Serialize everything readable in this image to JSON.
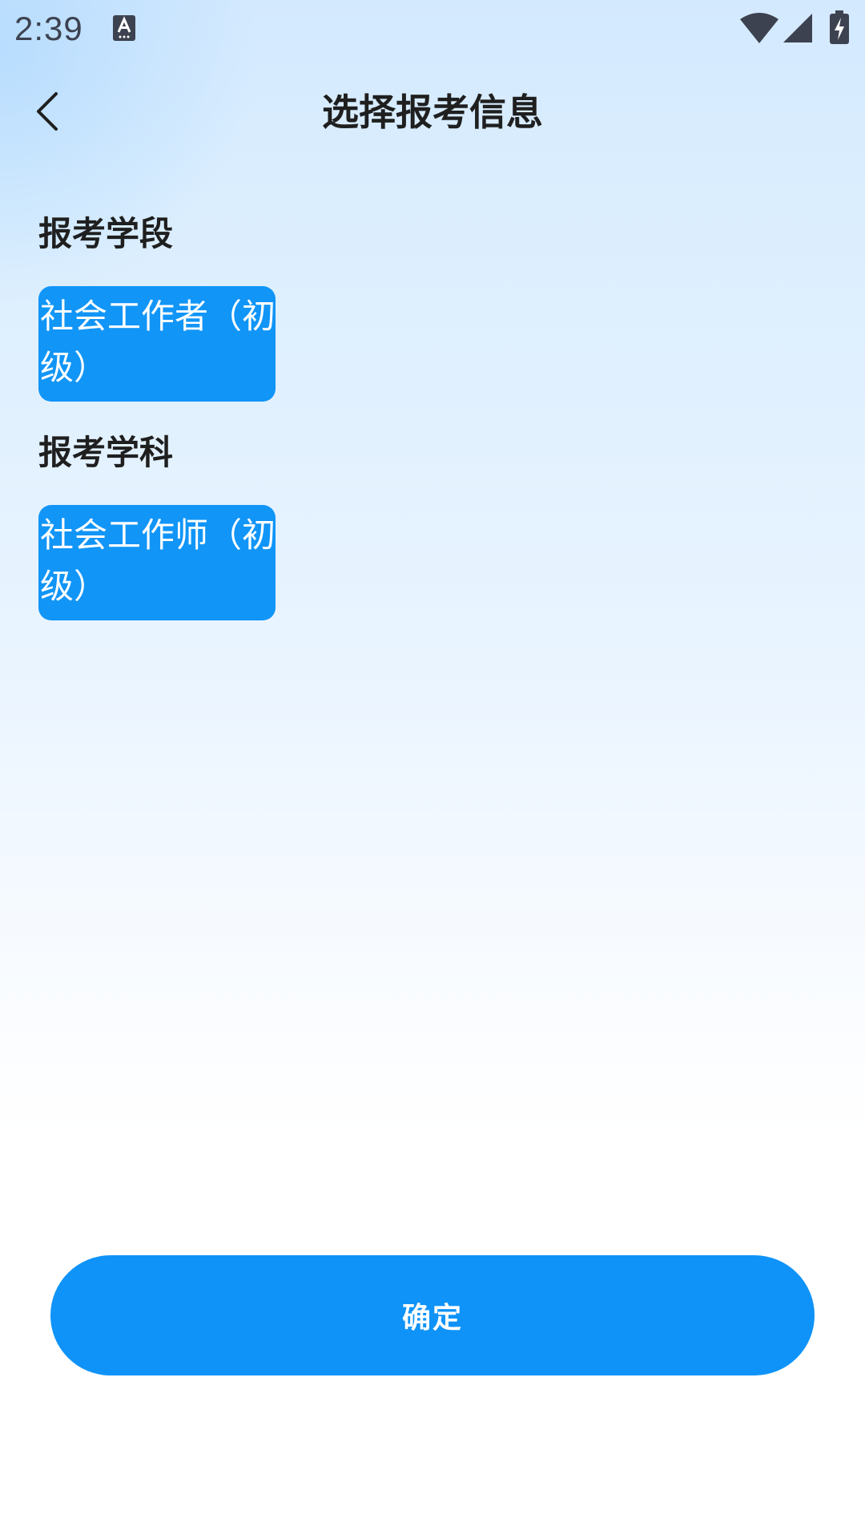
{
  "status_bar": {
    "time": "2:39",
    "notification_icon": "keyboard-a-icon",
    "wifi_icon": "wifi-icon",
    "signal_icon": "cell-signal-icon",
    "battery_icon": "battery-charging-icon"
  },
  "nav": {
    "back_icon": "chevron-left-icon",
    "title": "选择报考信息"
  },
  "level_section": {
    "label": "报考学段",
    "option": "社会工作者（初级）"
  },
  "subject_section": {
    "label": "报考学科",
    "option": "社会工作师（初级）"
  },
  "confirm_label": "确定",
  "colors": {
    "accent": "#1195f7",
    "button": "#0f93f8",
    "text": "#1f1f1f",
    "status_icons": "#3d4250"
  }
}
